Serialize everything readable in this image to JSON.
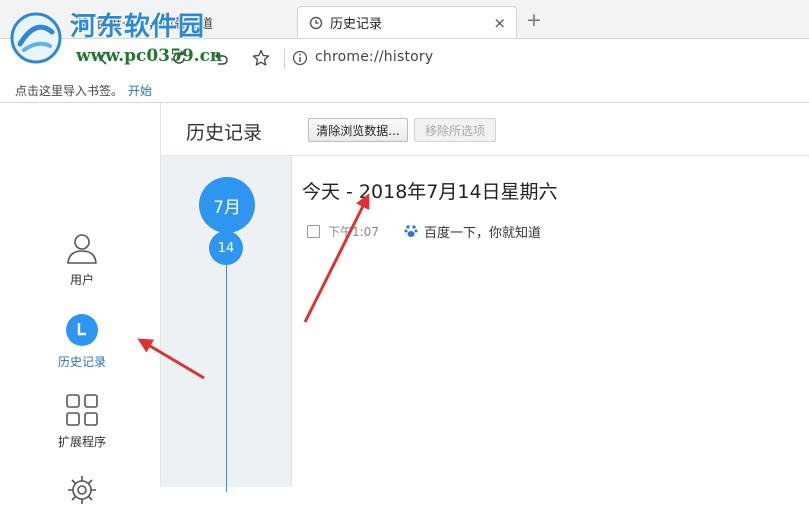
{
  "tabs": [
    {
      "label": "百度一下，你就知道",
      "icon": "paw-icon"
    },
    {
      "label": "历史记录",
      "icon": "history-clock-icon",
      "close": "×"
    }
  ],
  "new_tab": "+",
  "watermark": {
    "title": "河东软件园",
    "url": "www.pc0359.cn"
  },
  "address_bar": {
    "url": "chrome://history"
  },
  "bookmarks_bar": {
    "prompt": "点击这里导入书签。",
    "link": "开始"
  },
  "sidebar": {
    "items": [
      {
        "label": "用户",
        "icon": "user-icon"
      },
      {
        "label": "历史记录",
        "icon": "history-clock-icon",
        "active": true
      },
      {
        "label": "扩展程序",
        "icon": "grid-icon"
      }
    ]
  },
  "header": {
    "title": "历史记录",
    "clear_button": "清除浏览数据...",
    "remove_button": "移除所选项"
  },
  "timeline": {
    "month": "7月",
    "day": "14"
  },
  "history": {
    "day_heading": "今天 - 2018年7月14日星期六",
    "entries": [
      {
        "time": "下午1:07",
        "title": "百度一下，你就知道",
        "icon": "paw-icon"
      }
    ]
  },
  "colors": {
    "accent": "#2e95f0",
    "link": "#2a6fc9",
    "arrow": "#e03030",
    "watermark": "#2a8ad8"
  }
}
